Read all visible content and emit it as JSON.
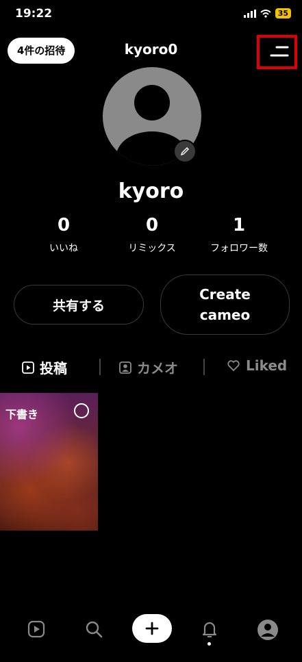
{
  "status_bar": {
    "time": "19:22",
    "battery": "35"
  },
  "header": {
    "invite_label": "4件の招待",
    "username": "kyoro0"
  },
  "profile": {
    "display_name": "kyoro",
    "stats": [
      {
        "value": "0",
        "label": "いいね"
      },
      {
        "value": "0",
        "label": "リミックス"
      },
      {
        "value": "1",
        "label": "フォロワー数"
      }
    ]
  },
  "actions": {
    "share_label": "共有する",
    "cameo_line1": "Create",
    "cameo_line2": "cameo"
  },
  "tabs": [
    {
      "label": "投稿",
      "icon": "play-square-icon",
      "active": true
    },
    {
      "label": "カメオ",
      "icon": "person-frame-icon",
      "active": false
    },
    {
      "label": "Liked",
      "icon": "heart-icon",
      "active": false
    }
  ],
  "posts": [
    {
      "label": "下書き"
    }
  ],
  "colors": {
    "highlight": "#e00000",
    "inactive": "#8a8a8a",
    "battery": "#f2c200"
  }
}
